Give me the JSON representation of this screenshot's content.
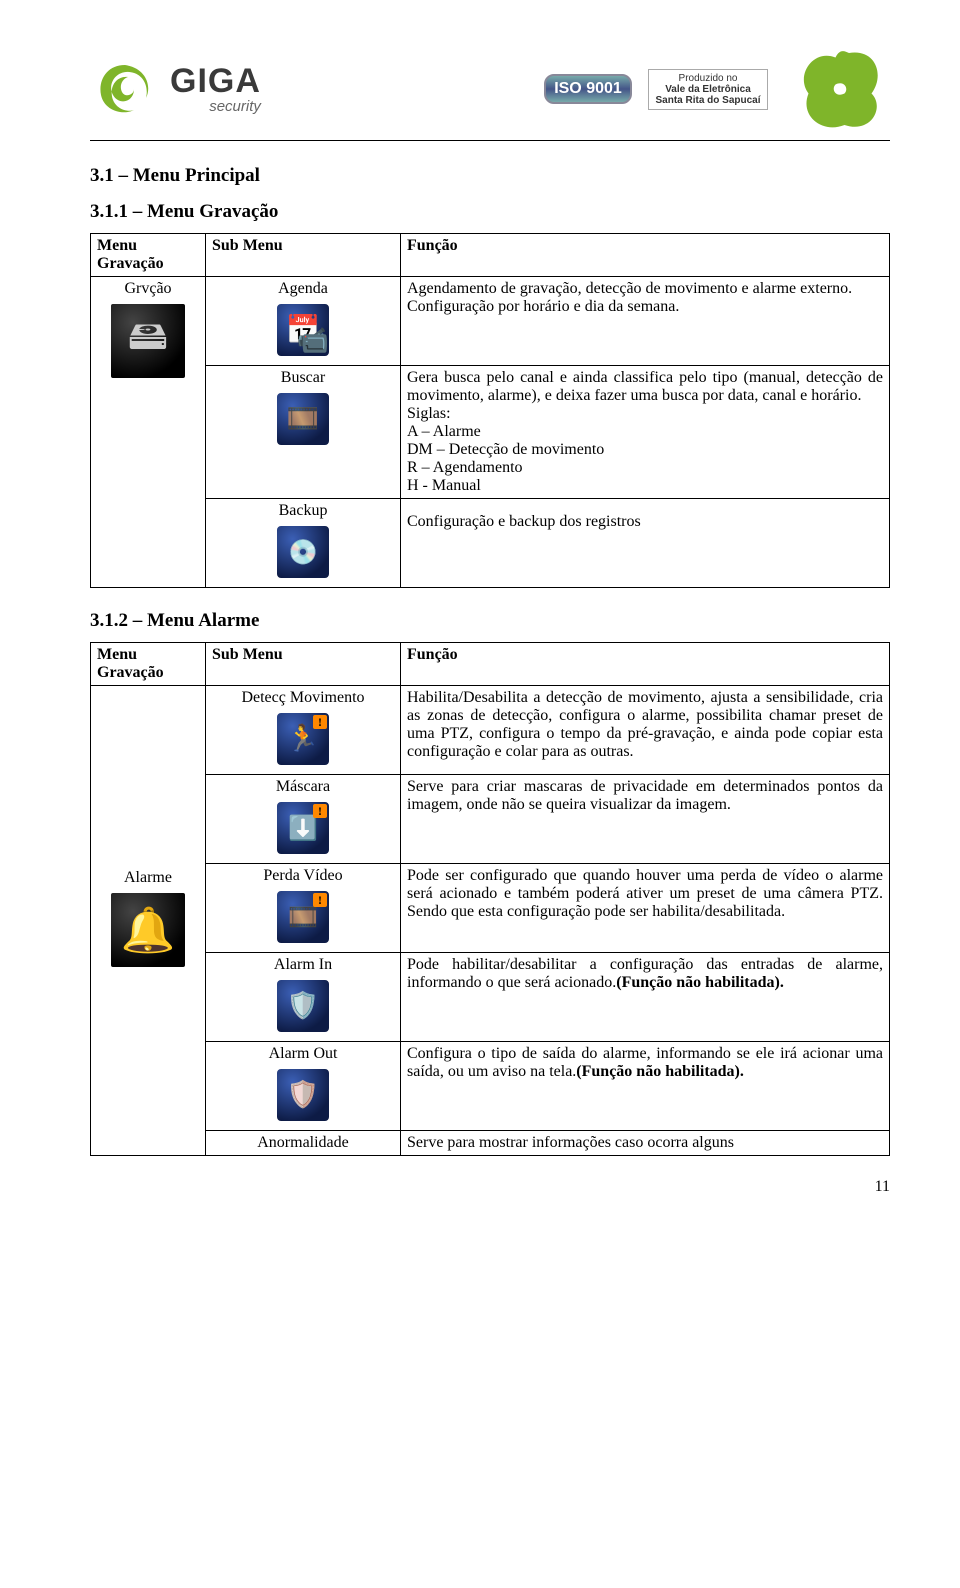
{
  "header": {
    "brand": "GIGA",
    "brand_sub": "security",
    "iso_text": "ISO 9001",
    "badge2_line1": "Produzido no",
    "badge2_line2": "Vale da Eletrônica",
    "badge2_line3": "Santa Rita do Sapucaí"
  },
  "section1": {
    "heading": "3.1 – Menu Principal",
    "subheading": "3.1.1 – Menu Gravação"
  },
  "table1": {
    "cols": {
      "menu": "Menu Gravação",
      "sub": "Sub Menu",
      "func": "Função"
    },
    "menu_label": "Grvção",
    "rows": [
      {
        "sub": "Agenda",
        "func": "Agendamento de gravação, detecção de movimento e alarme externo.",
        "func2": "Configuração por horário e dia da semana."
      },
      {
        "sub": "Buscar",
        "func_intro": "Gera busca pelo canal e ainda classifica pelo tipo (manual, detecção de movimento, alarme), e deixa fazer uma busca por data, canal e horário.",
        "siglas_label": "Siglas:",
        "s1": "A – Alarme",
        "s2": "DM – Detecção de movimento",
        "s3": "R – Agendamento",
        "s4": "H -  Manual"
      },
      {
        "sub": "Backup",
        "func": "Configuração e backup dos registros"
      }
    ]
  },
  "section2": {
    "heading": "3.1.2 – Menu Alarme"
  },
  "table2": {
    "cols": {
      "menu": "Menu Gravação",
      "sub": "Sub Menu",
      "func": "Função"
    },
    "menu_label": "Alarme",
    "rows": [
      {
        "sub": "Detecç Movimento",
        "func": "Habilita/Desabilita a detecção de movimento, ajusta a sensibilidade, cria as zonas de detecção, configura o alarme, possibilita chamar preset de uma PTZ, configura o tempo da pré-gravação, e ainda pode copiar esta configuração e colar para as outras."
      },
      {
        "sub": "Máscara",
        "func": "Serve para criar mascaras de privacidade em determinados pontos da imagem, onde não se queira visualizar da imagem."
      },
      {
        "sub": "Perda Vídeo",
        "func": "Pode ser configurado que quando houver uma perda de vídeo o alarme será acionado e também poderá ativer um preset de uma câmera PTZ. Sendo que esta configuração pode ser habilita/desabilitada."
      },
      {
        "sub": "Alarm In",
        "func_a": "Pode habilitar/desabilitar a configuração das entradas de alarme, informando o que será acionado.",
        "func_b": "(Função não habilitada)."
      },
      {
        "sub": "Alarm Out",
        "func_a": "Configura o tipo de saída do alarme, informando se ele irá acionar uma saída, ou um aviso na tela.",
        "func_b": "(Função não habilitada)."
      },
      {
        "sub": "Anormalidade",
        "func": "Serve para mostrar informações caso ocorra alguns"
      }
    ]
  },
  "page_number": "11"
}
